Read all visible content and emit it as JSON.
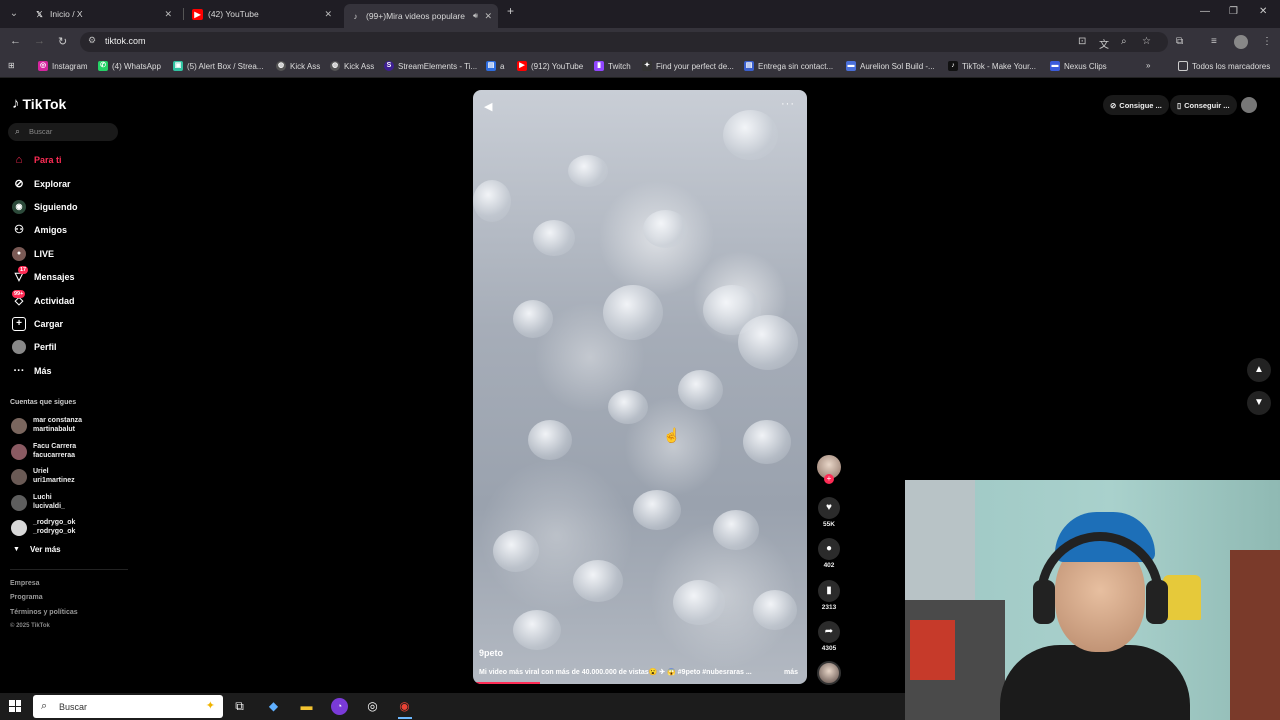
{
  "browser": {
    "tabs": [
      {
        "title": "Inicio / X",
        "icon": "x-logo-icon"
      },
      {
        "title": "(42) YouTube",
        "icon": "youtube-icon"
      },
      {
        "title": "(99+)Mira videos populare",
        "icon": "tiktok-icon",
        "active": true
      }
    ],
    "url": "tiktok.com",
    "bookmarks": [
      {
        "label": "Instagram",
        "color": "#d6249f"
      },
      {
        "label": "(4) WhatsApp",
        "color": "#25d366"
      },
      {
        "label": "(5) Alert Box / Strea...",
        "color": "#31c3a2"
      },
      {
        "label": "Kick Ass",
        "color": "#555555"
      },
      {
        "label": "Kick Ass",
        "color": "#555555"
      },
      {
        "label": "StreamElements - Ti...",
        "color": "#3e1f92"
      },
      {
        "label": "a",
        "color": "#2d6cdf"
      },
      {
        "label": "(912) YouTube",
        "color": "#ff0000"
      },
      {
        "label": "Twitch",
        "color": "#9146ff"
      },
      {
        "label": "Find your perfect de...",
        "color": "#333333"
      },
      {
        "label": "Entrega sin contact...",
        "color": "#3a5fcd"
      },
      {
        "label": "Aurelion Sol Build -...",
        "color": "#4a6fd8"
      },
      {
        "label": "TikTok - Make Your...",
        "color": "#111111"
      },
      {
        "label": "Nexus Clips",
        "color": "#3b5bdb"
      }
    ],
    "all_bookmarks": "Todos los marcadores"
  },
  "tiktok": {
    "logo": "TikTok",
    "search_placeholder": "Buscar",
    "nav": [
      {
        "label": "Para ti",
        "icon": "home-icon"
      },
      {
        "label": "Explorar",
        "icon": "compass-icon"
      },
      {
        "label": "Siguiendo",
        "icon": "following-icon"
      },
      {
        "label": "Amigos",
        "icon": "friends-icon"
      },
      {
        "label": "LIVE",
        "icon": "live-icon"
      },
      {
        "label": "Mensajes",
        "icon": "messages-icon",
        "badge": "17"
      },
      {
        "label": "Actividad",
        "icon": "activity-icon",
        "badge": "99+"
      },
      {
        "label": "Cargar",
        "icon": "upload-icon"
      },
      {
        "label": "Perfil",
        "icon": "profile-icon"
      },
      {
        "label": "Más",
        "icon": "more-icon"
      }
    ],
    "following_title": "Cuentas que sigues",
    "following": [
      {
        "name": "mar constanza",
        "handle": "martinabalut"
      },
      {
        "name": "Facu Carrera",
        "handle": "facucarreraa"
      },
      {
        "name": "Uriel",
        "handle": "uri1martinez"
      },
      {
        "name": "Luchi",
        "handle": "lucivaldi_"
      },
      {
        "name": "_rodrygo_ok",
        "handle": "_rodrygo_ok"
      }
    ],
    "see_more": "Ver más",
    "footer": [
      "Empresa",
      "Programa",
      "Términos y políticas"
    ],
    "copyright": "© 2025 TikTok",
    "top_pills": [
      "Consigue ...",
      "Conseguir ..."
    ],
    "video": {
      "username": "9peto",
      "caption": "Mi video más viral con más de 40.000.000 de vistas😮 ✈ 😱 #9peto #nubesraras ...",
      "more": "más",
      "progress": 0.2
    },
    "actions": {
      "likes": "55K",
      "comments": "402",
      "saves": "2313",
      "shares": "4305"
    }
  },
  "taskbar": {
    "search_placeholder": "Buscar"
  }
}
